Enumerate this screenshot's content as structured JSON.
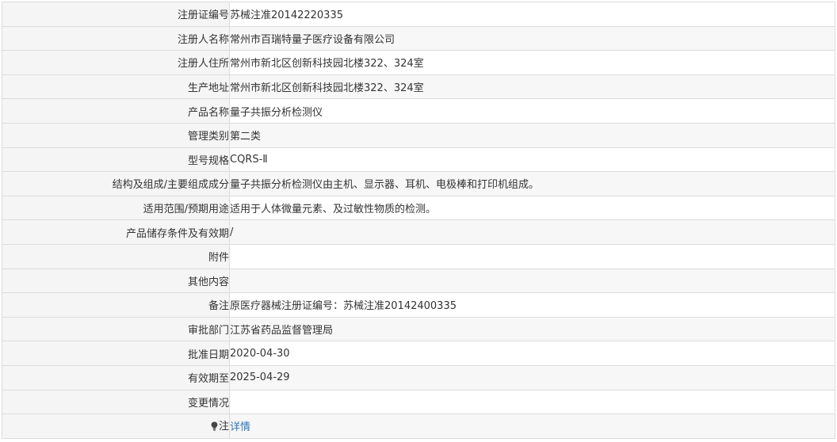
{
  "rows": [
    {
      "label": "注册证编号",
      "value": "苏械注准20142220335"
    },
    {
      "label": "注册人名称",
      "value": "常州市百瑞特量子医疗设备有限公司"
    },
    {
      "label": "注册人住所",
      "value": "常州市新北区创新科技园北楼322、324室"
    },
    {
      "label": "生产地址",
      "value": "常州市新北区创新科技园北楼322、324室"
    },
    {
      "label": "产品名称",
      "value": "量子共振分析检测仪"
    },
    {
      "label": "管理类别",
      "value": "第二类"
    },
    {
      "label": "型号规格",
      "value": "CQRS-Ⅱ"
    },
    {
      "label": "结构及组成/主要组成成分",
      "value": "量子共振分析检测仪由主机、显示器、耳机、电极棒和打印机组成。"
    },
    {
      "label": "适用范围/预期用途",
      "value": "适用于人体微量元素、及过敏性物质的检测。"
    },
    {
      "label": "产品储存条件及有效期",
      "value": "/"
    },
    {
      "label": "附件",
      "value": ""
    },
    {
      "label": "其他内容",
      "value": ""
    },
    {
      "label": "备注",
      "value": "原医疗器械注册证编号：苏械注准20142400335"
    },
    {
      "label": "审批部门",
      "value": "江苏省药品监督管理局"
    },
    {
      "label": "批准日期",
      "value": "2020-04-30"
    },
    {
      "label": "有效期至",
      "value": "2025-04-29"
    },
    {
      "label": "变更情况",
      "value": ""
    }
  ],
  "note": {
    "label": "注",
    "icon": "lightbulb-icon",
    "link_text": "详情"
  }
}
